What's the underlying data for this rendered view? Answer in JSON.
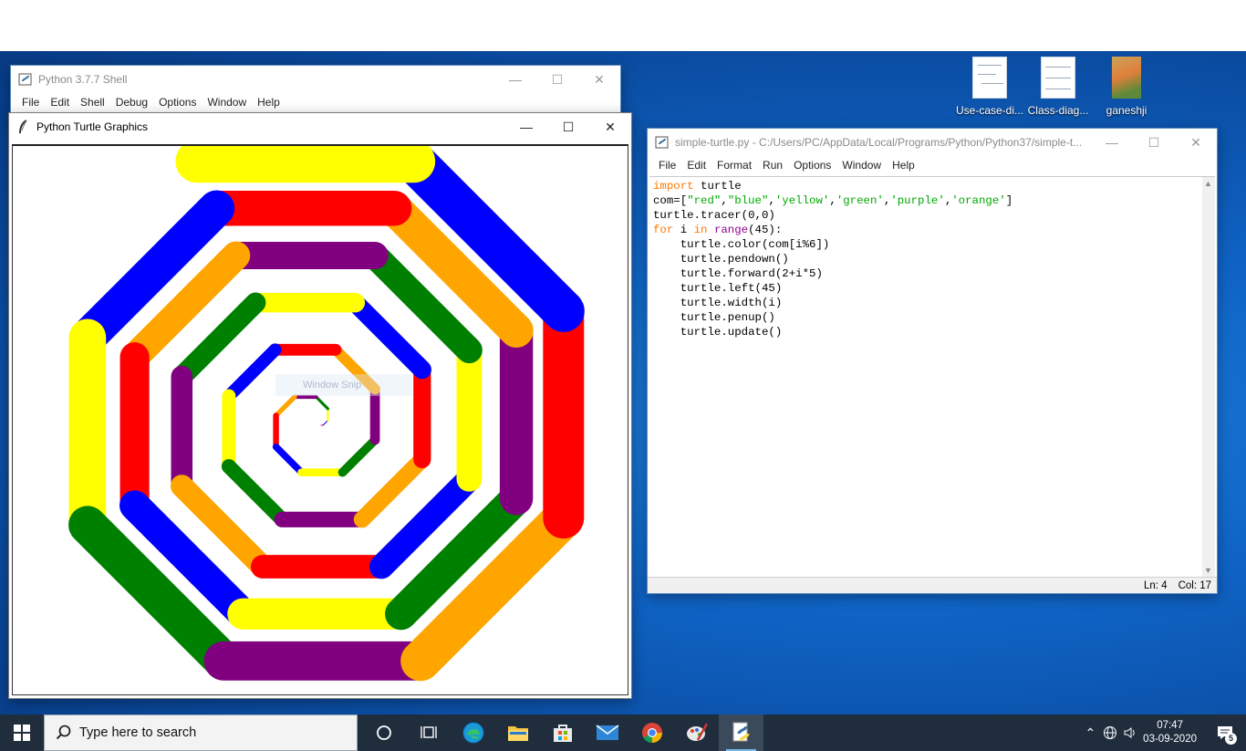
{
  "desktop": {
    "icons": [
      {
        "label": "Use-case-di..."
      },
      {
        "label": "Class-diag..."
      },
      {
        "label": "ganeshji"
      }
    ]
  },
  "shell_window": {
    "title": "Python 3.7.7 Shell",
    "menu": [
      "File",
      "Edit",
      "Shell",
      "Debug",
      "Options",
      "Window",
      "Help"
    ]
  },
  "turtle_window": {
    "title": "Python Turtle Graphics",
    "overlay_text": "Window Snip",
    "palette": [
      "#ff0000",
      "#0000ff",
      "#ffff00",
      "#008000",
      "#800080",
      "#ffa500"
    ],
    "step_count": 45
  },
  "editor_window": {
    "title": "simple-turtle.py - C:/Users/PC/AppData/Local/Programs/Python/Python37/simple-t...",
    "menu": [
      "File",
      "Edit",
      "Format",
      "Run",
      "Options",
      "Window",
      "Help"
    ],
    "code": [
      [
        {
          "t": "import",
          "c": "kw"
        },
        {
          "t": " turtle"
        }
      ],
      [
        {
          "t": "com=["
        },
        {
          "t": "\"red\"",
          "c": "str"
        },
        {
          "t": ","
        },
        {
          "t": "\"blue\"",
          "c": "str"
        },
        {
          "t": ","
        },
        {
          "t": "'yellow'",
          "c": "str"
        },
        {
          "t": ","
        },
        {
          "t": "'green'",
          "c": "str"
        },
        {
          "t": ","
        },
        {
          "t": "'purple'",
          "c": "str"
        },
        {
          "t": ","
        },
        {
          "t": "'orange'",
          "c": "str"
        },
        {
          "t": "]"
        }
      ],
      [
        {
          "t": "turtle.tracer(0,0)"
        }
      ],
      [
        {
          "t": "for",
          "c": "kw"
        },
        {
          "t": " i "
        },
        {
          "t": "in",
          "c": "kw"
        },
        {
          "t": " "
        },
        {
          "t": "range",
          "c": "bi"
        },
        {
          "t": "(45):"
        }
      ],
      [
        {
          "t": "    turtle.color(com[i%6])"
        }
      ],
      [
        {
          "t": "    turtle.pendown()"
        }
      ],
      [
        {
          "t": "    turtle.forward(2+i*5)"
        }
      ],
      [
        {
          "t": "    turtle.left(45)"
        }
      ],
      [
        {
          "t": "    turtle.width(i)"
        }
      ],
      [
        {
          "t": "    turtle.penup()"
        }
      ],
      [
        {
          "t": "    turtle.update()"
        }
      ]
    ],
    "status_line": "Ln: 4",
    "status_col": "Col: 17"
  },
  "taskbar": {
    "search_placeholder": "Type here to search",
    "time": "07:47",
    "date": "03-09-2020",
    "notification_count": "5"
  },
  "colors": {
    "taskbar": "#1f2d3d",
    "desktop": "#0f64c6"
  }
}
